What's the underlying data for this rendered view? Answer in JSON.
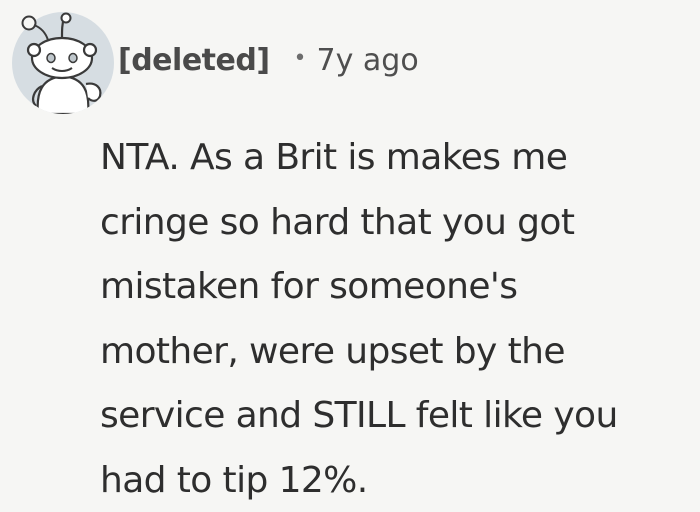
{
  "comment": {
    "username": "[deleted]",
    "separator": "•",
    "age": "7y ago",
    "avatar_icon": "snoo-avatar-icon",
    "body_lines": [
      "NTA. As a Brit is makes me",
      "cringe so hard that you got",
      "mistaken for someone's",
      "mother, were upset by the",
      "service and STILL felt like you",
      "had to tip 12%."
    ]
  }
}
